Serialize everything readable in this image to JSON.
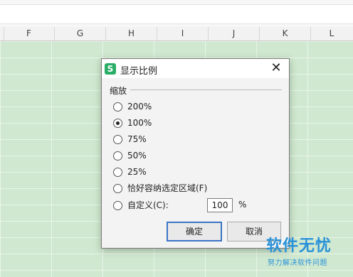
{
  "columns": [
    "F",
    "G",
    "H",
    "I",
    "J",
    "K",
    "L"
  ],
  "dialog": {
    "title": "显示比例",
    "app_logo": "S",
    "close_symbol": "✕",
    "group_label": "缩放",
    "options": [
      {
        "label": "200%",
        "checked": false
      },
      {
        "label": "100%",
        "checked": true
      },
      {
        "label": "75%",
        "checked": false
      },
      {
        "label": "50%",
        "checked": false
      },
      {
        "label": "25%",
        "checked": false
      },
      {
        "label": "恰好容纳选定区域(F)",
        "checked": false
      },
      {
        "label": "自定义(C):",
        "checked": false
      }
    ],
    "custom_value": "100",
    "custom_unit": "%",
    "ok_label": "确定",
    "cancel_label": "取消"
  },
  "watermark": {
    "main": "软件无忧",
    "sub": "努力解决软件问题"
  },
  "colors": {
    "grid_fill": "#cfe8cf",
    "app_logo": "#2aae67",
    "primary_border": "#3a74c4",
    "watermark": "#2a92d8"
  }
}
